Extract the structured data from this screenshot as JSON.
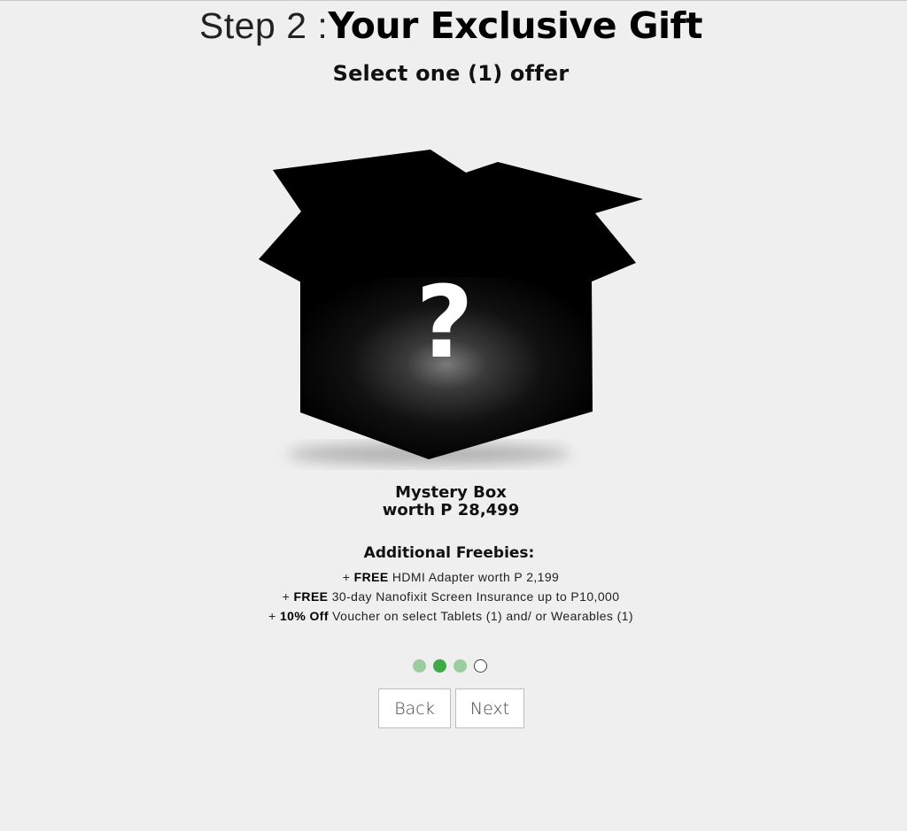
{
  "header": {
    "step_label": "Step 2 :",
    "title": "Your Exclusive Gift",
    "subtitle": "Select one (1) offer"
  },
  "gift": {
    "image_icon": "mystery-box-question-mark",
    "image_glyph": "?",
    "name": "Mystery Box",
    "worth": "worth P 28,499"
  },
  "freebies": {
    "heading": "Additional Freebies:",
    "items": [
      {
        "prefix": "+ ",
        "highlight": "FREE",
        "text": " HDMI Adapter worth P 2,199"
      },
      {
        "prefix": "+ ",
        "highlight": "FREE",
        "text": " 30-day Nanofixit Screen Insurance up to P10,000"
      },
      {
        "prefix": "+ ",
        "highlight": "10% Off",
        "text": " Voucher on select Tablets (1) and/ or Wearables (1)"
      }
    ]
  },
  "progress": {
    "steps": [
      "done",
      "active",
      "done",
      "todo"
    ],
    "colors": {
      "done": "#9dcd9f",
      "active": "#3da947",
      "todo": "#ffffff"
    }
  },
  "nav": {
    "back_label": "Back",
    "next_label": "Next"
  }
}
